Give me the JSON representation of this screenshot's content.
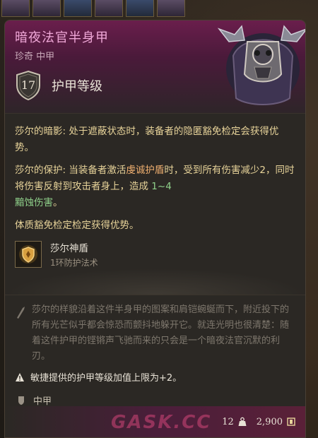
{
  "item": {
    "title": "暗夜法官半身甲",
    "subtitle": "珍奇 中甲",
    "armor_class": "17",
    "armor_class_label": "护甲等级"
  },
  "effects": [
    {
      "name": "莎尔的暗影:",
      "text": " 处于遮蔽状态时，装备者的隐匿豁免检定会获得优势。"
    },
    {
      "name": "莎尔的保护:",
      "text_before": " 当装备者激活",
      "highlight": "虔诚护盾",
      "text_middle": "时，受到所有伤害减少2，同时将伤害反射到攻击者身上，造成 ",
      "damage": "1~4",
      "damage_type": "黯蚀伤害",
      "text_after": "。"
    },
    {
      "text": "体质豁免检定检定获得优势。"
    }
  ],
  "spell": {
    "name": "莎尔神盾",
    "level": "1环防护法术",
    "icon": "shield-spell-icon"
  },
  "lore": "莎尔的样貌沿着这件半身甲的图案和肩铠蜿蜒而下，附近投下的所有光芒似乎都会惊恐而颤抖地躲开它。就连光明也很清楚：随着这件护甲的铿锵声飞驰而来的只会是一个暗夜法官沉默的利刃。",
  "note": "敏捷提供的护甲等级加值上限为+2。",
  "armor_type": "中甲",
  "footer": {
    "weight": "12",
    "value": "2,900"
  },
  "watermark": "GASK.CC",
  "colors": {
    "title": "#f0a8d8",
    "effect_text": "#e8d49a",
    "damage": "#8fd08a",
    "rarity_header": "#6a1e4c"
  }
}
